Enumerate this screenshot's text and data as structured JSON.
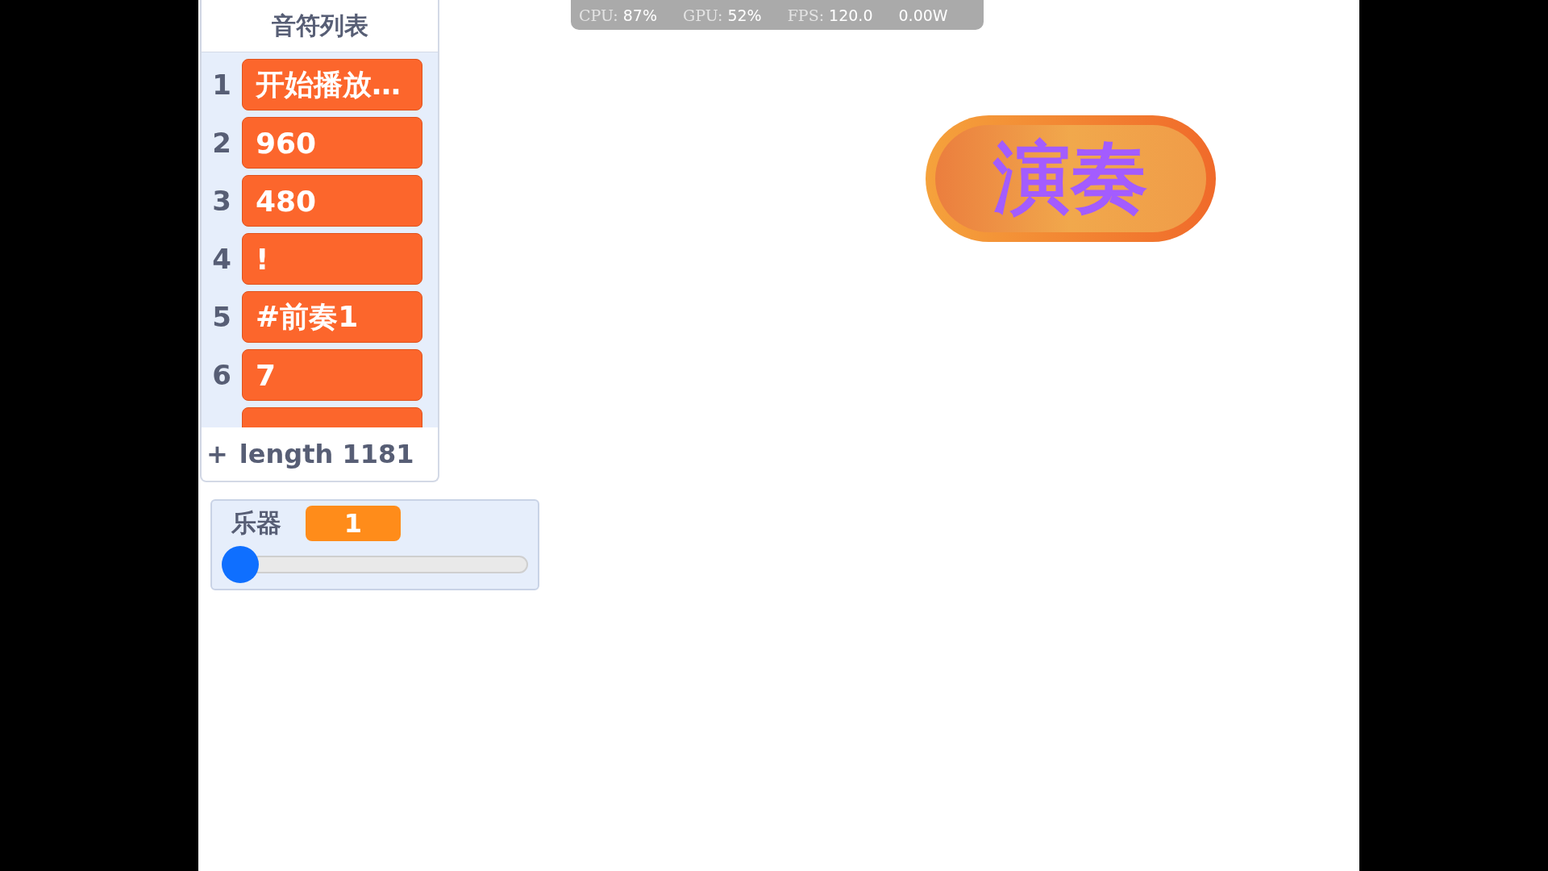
{
  "stats_bar": [
    {
      "label": "CPU:",
      "value": "87%"
    },
    {
      "label": "GPU:",
      "value": "52%"
    },
    {
      "label": "FPS:",
      "value": "120.0"
    },
    {
      "value": "0.00W"
    }
  ],
  "list_monitor": {
    "title": "音符列表",
    "items": [
      {
        "index": "1",
        "value": "开始播放…"
      },
      {
        "index": "2",
        "value": "960"
      },
      {
        "index": "3",
        "value": "480"
      },
      {
        "index": "4",
        "value": "!"
      },
      {
        "index": "5",
        "value": "#前奏1"
      },
      {
        "index": "6",
        "value": "7"
      }
    ],
    "add": "+",
    "length": "length 1181"
  },
  "variable_monitor": {
    "label": "乐器",
    "value": "1",
    "level": 0
  },
  "play_button": {
    "label": "演奏"
  }
}
